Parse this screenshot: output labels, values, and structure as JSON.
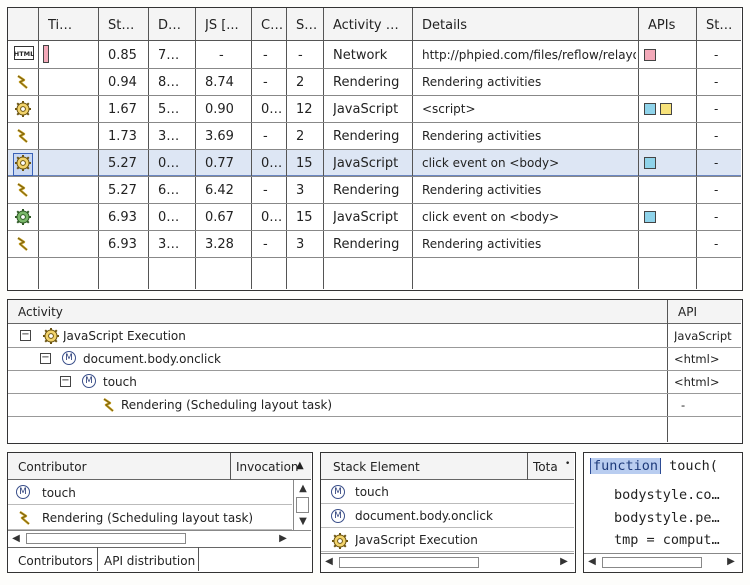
{
  "timeline": {
    "columns": [
      "Ti…",
      "St…",
      "D…",
      "JS [...",
      "C…",
      "S…",
      "Activity …",
      "Details",
      "APIs",
      "St…"
    ],
    "rows": [
      {
        "icon": "html-icon",
        "st": "0.85",
        "d": "7…",
        "js": "-",
        "c": "-",
        "s": "-",
        "activity": "Network",
        "details": "http://phpied.com/files/reflow/relayo…",
        "apis": [
          "#f3a9b9"
        ],
        "status": "-",
        "has_bar": true
      },
      {
        "icon": "rendering-icon",
        "st": "0.94",
        "d": "8…",
        "js": "8.74",
        "c": "-",
        "s": "2",
        "activity": "Rendering",
        "details": "Rendering activities",
        "apis": [],
        "status": "-"
      },
      {
        "icon": "javascript-gear-icon",
        "st": "1.67",
        "d": "5…",
        "js": "0.90",
        "c": "0…",
        "s": "12",
        "activity": "JavaScript",
        "details": "<script>",
        "apis": [
          "#8fd3ea",
          "#f7e27a"
        ],
        "status": "-"
      },
      {
        "icon": "rendering-icon",
        "st": "1.73",
        "d": "3…",
        "js": "3.69",
        "c": "-",
        "s": "2",
        "activity": "Rendering",
        "details": "Rendering activities",
        "apis": [],
        "status": "-"
      },
      {
        "icon": "javascript-gear-icon",
        "st": "5.27",
        "d": "0…",
        "js": "0.77",
        "c": "0…",
        "s": "15",
        "activity": "JavaScript",
        "details": "click event on <body>",
        "apis": [
          "#8fd3ea"
        ],
        "status": "-",
        "selected": true
      },
      {
        "icon": "rendering-icon",
        "st": "5.27",
        "d": "6…",
        "js": "6.42",
        "c": "-",
        "s": "3",
        "activity": "Rendering",
        "details": "Rendering activities",
        "apis": [],
        "status": "-"
      },
      {
        "icon": "event-gear-icon",
        "st": "6.93",
        "d": "0…",
        "js": "0.67",
        "c": "0…",
        "s": "15",
        "activity": "JavaScript",
        "details": "click event on <body>",
        "apis": [
          "#8fd3ea"
        ],
        "status": "-"
      },
      {
        "icon": "rendering-icon",
        "st": "6.93",
        "d": "3…",
        "js": "3.28",
        "c": "-",
        "s": "3",
        "activity": "Rendering",
        "details": "Rendering activities",
        "apis": [],
        "status": "-"
      }
    ]
  },
  "activity_tree": {
    "col_activity": "Activity",
    "col_api": "API",
    "nodes": [
      {
        "label": "JavaScript Execution",
        "api": "JavaScript",
        "toggle": "−",
        "icon": "javascript-gear-icon"
      },
      {
        "label": "document.body.onclick",
        "api": "<html>",
        "toggle": "−",
        "icon": "method-icon"
      },
      {
        "label": "touch",
        "api": "<html>",
        "toggle": "−",
        "icon": "method-icon"
      },
      {
        "label": "Rendering (Scheduling layout task)",
        "api": "-",
        "toggle": "",
        "icon": "rendering-icon"
      }
    ]
  },
  "contributors": {
    "col_contributor": "Contributor",
    "col_invocation": "Invocation",
    "items": [
      {
        "label": "touch",
        "icon": "method-icon"
      },
      {
        "label": "Rendering (Scheduling layout task)",
        "icon": "rendering-icon"
      }
    ],
    "tabs": [
      "Contributors",
      "API distribution"
    ]
  },
  "stack": {
    "col_element": "Stack Element",
    "col_total": "Tota",
    "items": [
      {
        "label": "touch",
        "icon": "method-icon"
      },
      {
        "label": "document.body.onclick",
        "icon": "method-icon"
      },
      {
        "label": "JavaScript Execution",
        "icon": "javascript-gear-icon"
      }
    ]
  },
  "code": {
    "keyword": "function",
    "line0_rest": "touch(",
    "lines": [
      "bodystyle.co…",
      "bodystyle.pe…",
      "tmp = comput…"
    ]
  },
  "colors": {
    "selected_row": "#dde6f4",
    "accent": "#3a62b8",
    "keyword_highlight": "#b9cdf0"
  }
}
